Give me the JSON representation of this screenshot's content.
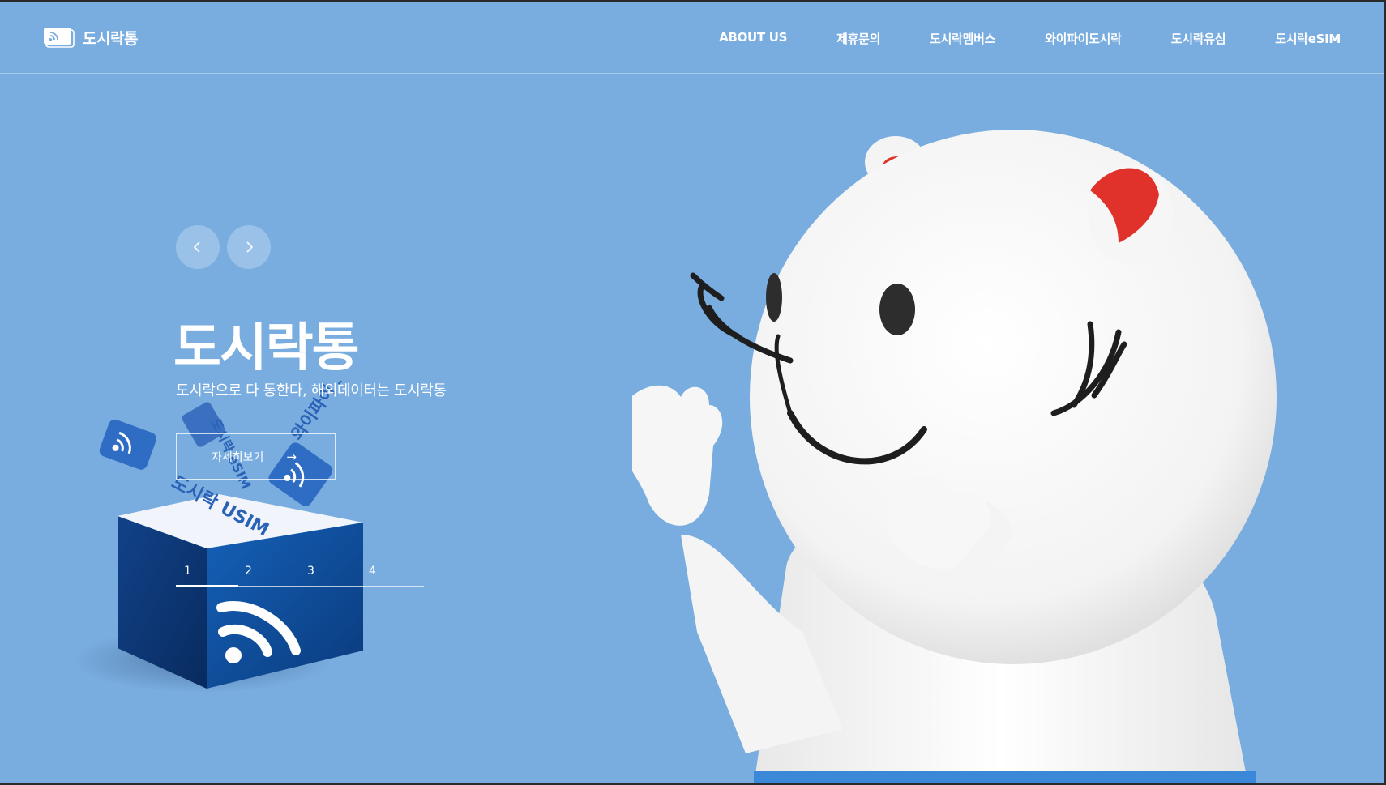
{
  "header": {
    "logo_text": "도시락통",
    "nav": [
      "ABOUT US",
      "제휴문의",
      "도시락멤버스",
      "와이파이도시락",
      "도시락유심",
      "도시락eSIM"
    ]
  },
  "hero": {
    "title": "도시락통",
    "subtitle": "도시락으로 다 통한다, 해외데이터는 도시락통",
    "cta_label": "자세히보기",
    "cta_arrow": "→"
  },
  "illustration": {
    "labels": [
      "도시락 USIM",
      "도시락 eSIM",
      "와이파이 도시락"
    ]
  },
  "pager": {
    "pages": [
      "1",
      "2",
      "3",
      "4"
    ],
    "active": 1
  },
  "colors": {
    "background": "#79acdf",
    "box_dark": "#0d3f86",
    "box_mid": "#1a5bb0",
    "accent_red": "#e0322b"
  },
  "icons": {
    "logo": "dosirak-logo-icon",
    "prev": "chevron-left-icon",
    "next": "chevron-right-icon"
  }
}
